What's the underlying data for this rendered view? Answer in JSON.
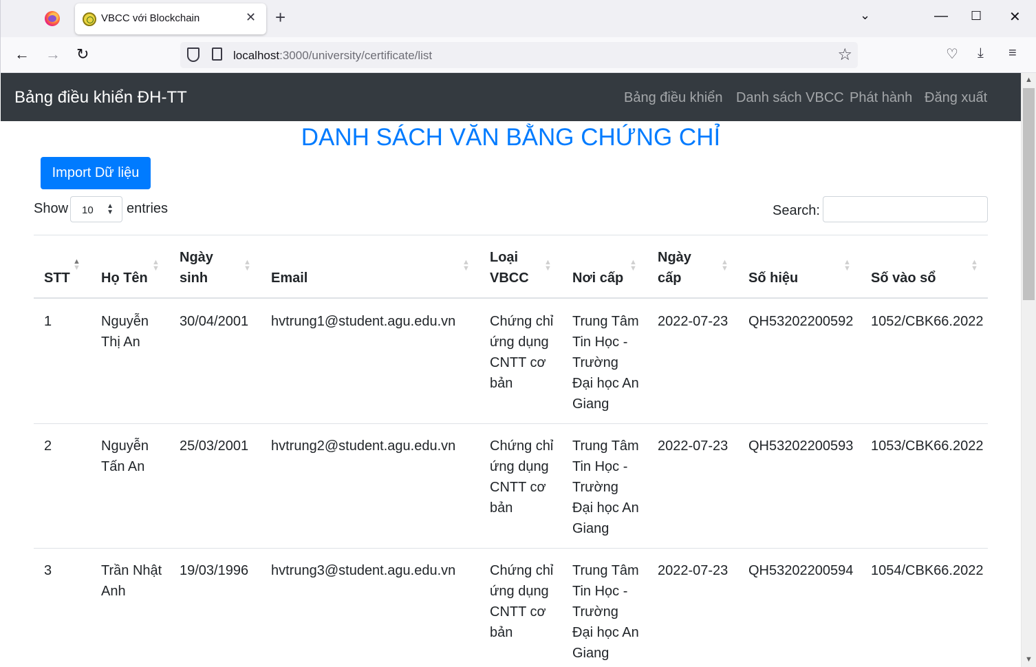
{
  "browser": {
    "tab_title": "VBCC với Blockchain",
    "url_host": "localhost",
    "url_path": ":3000/university/certificate/list"
  },
  "app": {
    "brand": "Bảng điều khiển ĐH-TT",
    "nav": [
      "Bảng điều khiển",
      "Danh sách VBCC",
      "Phát hành",
      "Đăng xuất"
    ],
    "page_title": "DANH SÁCH VĂN BẰNG CHỨNG CHỈ",
    "import_label": "Import Dữ liệu",
    "show_label": "Show",
    "entries_label": "entries",
    "page_length": "10",
    "search_label": "Search:",
    "search_value": ""
  },
  "table": {
    "columns": [
      {
        "label": "STT",
        "sort": "asc"
      },
      {
        "label": "Họ Tên",
        "sort": "none"
      },
      {
        "label": "Ngày sinh",
        "sort": "none"
      },
      {
        "label": "Email",
        "sort": "none"
      },
      {
        "label": "Loại VBCC",
        "sort": "none"
      },
      {
        "label": "Nơi cấp",
        "sort": "none"
      },
      {
        "label": "Ngày cấp",
        "sort": "none"
      },
      {
        "label": "Số hiệu",
        "sort": "none"
      },
      {
        "label": "Số vào sổ",
        "sort": "none"
      }
    ],
    "rows": [
      [
        "1",
        "Nguyễn Thị An",
        "30/04/2001",
        "hvtrung1@student.agu.edu.vn",
        "Chứng chỉ ứng dụng CNTT cơ bản",
        "Trung Tâm Tin Học - Trường Đại học An Giang",
        "2022-07-23",
        "QH53202200592",
        "1052/CBK66.2022"
      ],
      [
        "2",
        "Nguyễn Tấn An",
        "25/03/2001",
        "hvtrung2@student.agu.edu.vn",
        "Chứng chỉ ứng dụng CNTT cơ bản",
        "Trung Tâm Tin Học - Trường Đại học An Giang",
        "2022-07-23",
        "QH53202200593",
        "1053/CBK66.2022"
      ],
      [
        "3",
        "Trần Nhật Anh",
        "19/03/1996",
        "hvtrung3@student.agu.edu.vn",
        "Chứng chỉ ứng dụng CNTT cơ bản",
        "Trung Tâm Tin Học - Trường Đại học An Giang",
        "2022-07-23",
        "QH53202200594",
        "1054/CBK66.2022"
      ]
    ]
  }
}
